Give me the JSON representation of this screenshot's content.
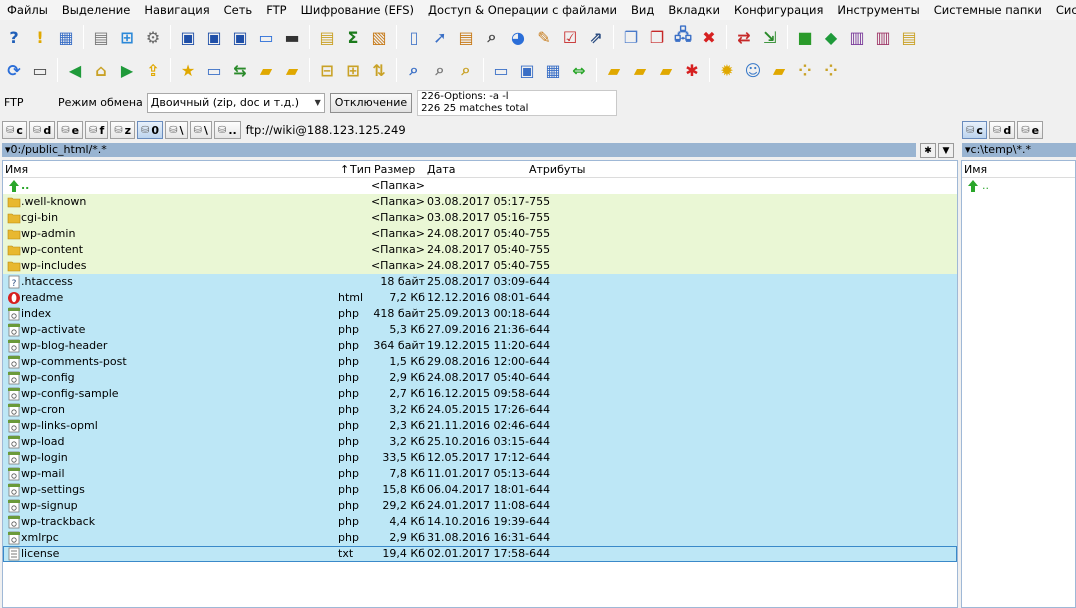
{
  "menu": [
    "Файлы",
    "Выделение",
    "Навигация",
    "Сеть",
    "FTP",
    "Шифрование (EFS)",
    "Доступ & Операции с файлами",
    "Вид",
    "Вкладки",
    "Конфигурация",
    "Инструменты",
    "Системные папки",
    "Системные диски"
  ],
  "ftpbar": {
    "label": "FTP",
    "mode_label": "Режим обмена",
    "mode_value": "Двоичный (zip, doc и т.д.)",
    "disconnect": "Отключение",
    "log": [
      "226-Options: -a -l",
      "226 25 matches total"
    ]
  },
  "drives_left": [
    {
      "letter": "c"
    },
    {
      "letter": "d"
    },
    {
      "letter": "e"
    },
    {
      "letter": "f"
    },
    {
      "letter": "z"
    },
    {
      "letter": "0"
    },
    {
      "letter": "\\"
    },
    {
      "letter": "\\"
    },
    {
      "letter": ".."
    }
  ],
  "ftp_path": "ftp://wiki@188.123.125.249",
  "drives_right": [
    {
      "letter": "c"
    },
    {
      "letter": "d"
    },
    {
      "letter": "e"
    }
  ],
  "left_panel": {
    "path": "0:/public_html/*.*",
    "headers": {
      "name": "Имя",
      "type": "Тип",
      "size": "Размер",
      "date": "Дата",
      "attrs": "Атрибуты"
    },
    "sort_marker": "↑"
  },
  "right_panel": {
    "path": "c:\\temp\\*.*",
    "headers": {
      "name": "Имя"
    },
    "up": ".."
  },
  "rows": [
    {
      "kind": "up",
      "name": "..",
      "ext": "",
      "size": "<Папка>",
      "date": ""
    },
    {
      "kind": "dir",
      "name": ".well-known",
      "ext": "",
      "size": "<Папка>",
      "date": "03.08.2017 05:17-755"
    },
    {
      "kind": "dir",
      "name": "cgi-bin",
      "ext": "",
      "size": "<Папка>",
      "date": "03.08.2017 05:16-755"
    },
    {
      "kind": "dir",
      "name": "wp-admin",
      "ext": "",
      "size": "<Папка>",
      "date": "24.08.2017 05:40-755"
    },
    {
      "kind": "dir",
      "name": "wp-content",
      "ext": "",
      "size": "<Папка>",
      "date": "24.08.2017 05:40-755"
    },
    {
      "kind": "dir",
      "name": "wp-includes",
      "ext": "",
      "size": "<Папка>",
      "date": "24.08.2017 05:40-755"
    },
    {
      "kind": "htaccess",
      "name": ".htaccess",
      "ext": "",
      "size": "18 байт",
      "date": "25.08.2017 03:09-644"
    },
    {
      "kind": "html",
      "name": "readme",
      "ext": "html",
      "size": "7,2 Кб",
      "date": "12.12.2016 08:01-644"
    },
    {
      "kind": "php",
      "name": "index",
      "ext": "php",
      "size": "418 байт",
      "date": "25.09.2013 00:18-644"
    },
    {
      "kind": "php",
      "name": "wp-activate",
      "ext": "php",
      "size": "5,3 Кб",
      "date": "27.09.2016 21:36-644"
    },
    {
      "kind": "php",
      "name": "wp-blog-header",
      "ext": "php",
      "size": "364 байт",
      "date": "19.12.2015 11:20-644"
    },
    {
      "kind": "php",
      "name": "wp-comments-post",
      "ext": "php",
      "size": "1,5 Кб",
      "date": "29.08.2016 12:00-644"
    },
    {
      "kind": "php",
      "name": "wp-config",
      "ext": "php",
      "size": "2,9 Кб",
      "date": "24.08.2017 05:40-644"
    },
    {
      "kind": "php",
      "name": "wp-config-sample",
      "ext": "php",
      "size": "2,7 Кб",
      "date": "16.12.2015 09:58-644"
    },
    {
      "kind": "php",
      "name": "wp-cron",
      "ext": "php",
      "size": "3,2 Кб",
      "date": "24.05.2015 17:26-644"
    },
    {
      "kind": "php",
      "name": "wp-links-opml",
      "ext": "php",
      "size": "2,3 Кб",
      "date": "21.11.2016 02:46-644"
    },
    {
      "kind": "php",
      "name": "wp-load",
      "ext": "php",
      "size": "3,2 Кб",
      "date": "25.10.2016 03:15-644"
    },
    {
      "kind": "php",
      "name": "wp-login",
      "ext": "php",
      "size": "33,5 Кб",
      "date": "12.05.2017 17:12-644"
    },
    {
      "kind": "php",
      "name": "wp-mail",
      "ext": "php",
      "size": "7,8 Кб",
      "date": "11.01.2017 05:13-644"
    },
    {
      "kind": "php",
      "name": "wp-settings",
      "ext": "php",
      "size": "15,8 Кб",
      "date": "06.04.2017 18:01-644"
    },
    {
      "kind": "php",
      "name": "wp-signup",
      "ext": "php",
      "size": "29,2 Кб",
      "date": "24.01.2017 11:08-644"
    },
    {
      "kind": "php",
      "name": "wp-trackback",
      "ext": "php",
      "size": "4,4 Кб",
      "date": "14.10.2016 19:39-644"
    },
    {
      "kind": "php",
      "name": "xmlrpc",
      "ext": "php",
      "size": "2,9 Кб",
      "date": "31.08.2016 16:31-644"
    },
    {
      "kind": "txt",
      "name": "license",
      "ext": "txt",
      "size": "19,4 Кб",
      "date": "02.01.2017 17:58-644",
      "selected": true
    }
  ]
}
